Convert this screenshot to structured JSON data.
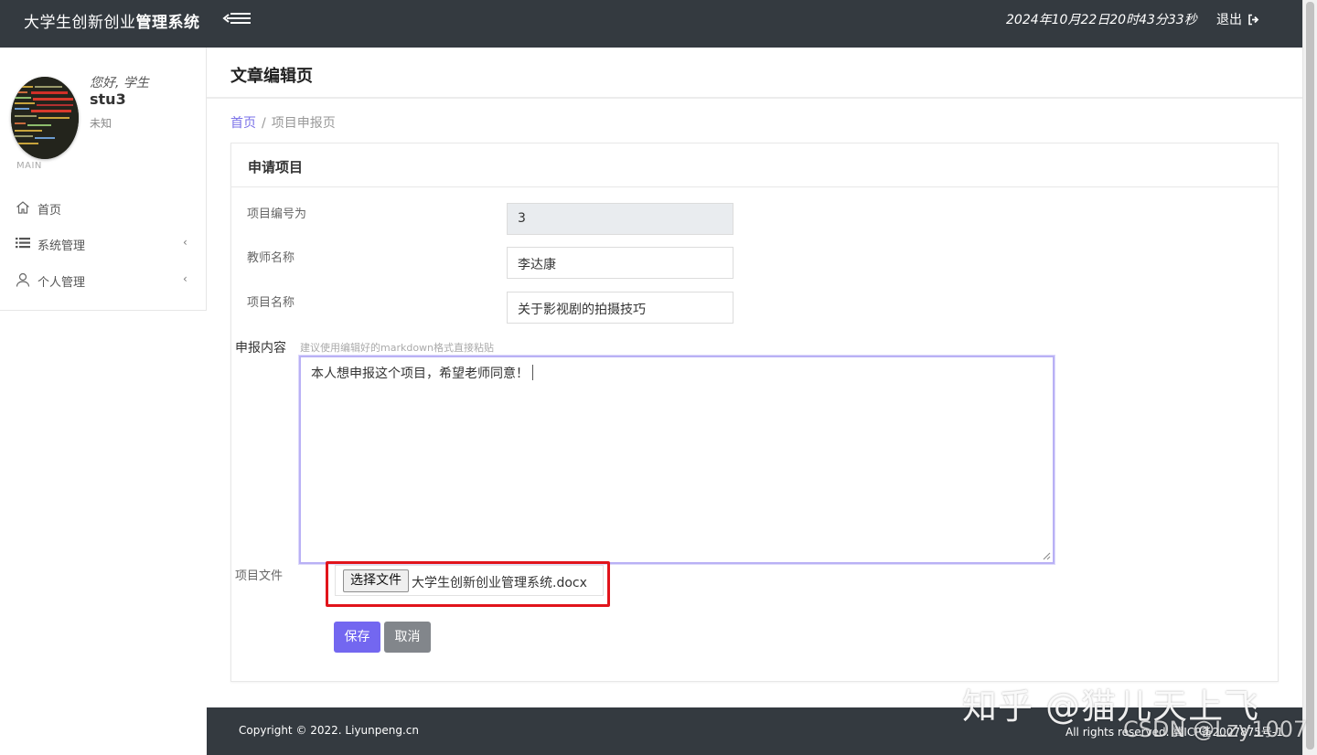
{
  "header": {
    "brand_normal": "大学生创新创业",
    "brand_bold": "管理系统",
    "datetime": "2024年10月22日20时43分33秒",
    "logout_label": "退出"
  },
  "sidebar": {
    "greeting": "您好, 学生",
    "username": "stu3",
    "status": "未知",
    "section_label": "MAIN",
    "items": [
      {
        "label": "首页",
        "icon": "home-icon"
      },
      {
        "label": "系统管理",
        "icon": "list-icon",
        "chevron": "‹"
      },
      {
        "label": "个人管理",
        "icon": "user-icon",
        "chevron": "‹"
      }
    ]
  },
  "page": {
    "title": "文章编辑页",
    "breadcrumb_home": "首页",
    "breadcrumb_sep": "/",
    "breadcrumb_current": "项目申报页"
  },
  "form": {
    "card_title": "申请项目",
    "fields": [
      {
        "label": "项目编号为",
        "value": "3",
        "readonly": true
      },
      {
        "label": "教师名称",
        "value": "李达康"
      },
      {
        "label": "项目名称",
        "value": "关于影视剧的拍摄技巧"
      }
    ],
    "content_label": "申报内容",
    "content_hint": "建议使用编辑好的markdown格式直接粘贴",
    "content_value": "本人想申报这个项目，希望老师同意！",
    "file_label": "项目文件",
    "file_button": "选择文件",
    "file_name": "大学生创新创业管理系统.docx",
    "save_label": "保存",
    "cancel_label": "取消"
  },
  "footer": {
    "copyright": "Copyright © 2022. Liyunpeng.cn",
    "rights": "All rights reserved. 冀ICP备2007875号-1"
  },
  "watermark": {
    "line1": "知乎 @猫儿天上飞",
    "line2": "CSDN @Lzy1007"
  },
  "colors": {
    "topbar": "#343a40",
    "accent": "#7367f0",
    "secondary": "#82868b",
    "highlight_box": "#e1141b"
  }
}
